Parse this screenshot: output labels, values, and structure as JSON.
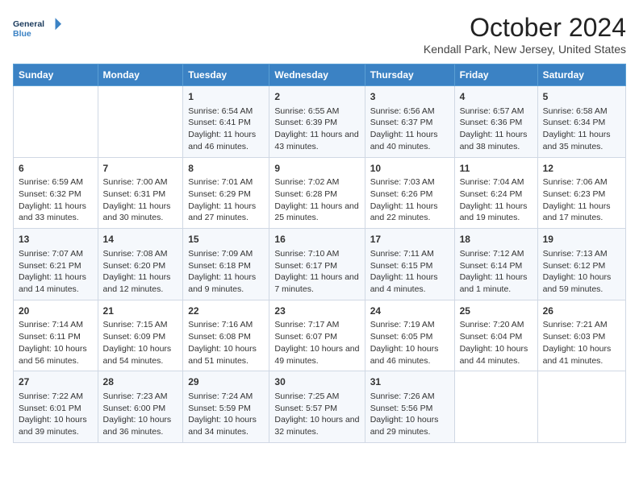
{
  "header": {
    "logo_line1": "General",
    "logo_line2": "Blue",
    "month_title": "October 2024",
    "location": "Kendall Park, New Jersey, United States"
  },
  "days_of_week": [
    "Sunday",
    "Monday",
    "Tuesday",
    "Wednesday",
    "Thursday",
    "Friday",
    "Saturday"
  ],
  "weeks": [
    [
      {
        "day": "",
        "sunrise": "",
        "sunset": "",
        "daylight": ""
      },
      {
        "day": "",
        "sunrise": "",
        "sunset": "",
        "daylight": ""
      },
      {
        "day": "1",
        "sunrise": "Sunrise: 6:54 AM",
        "sunset": "Sunset: 6:41 PM",
        "daylight": "Daylight: 11 hours and 46 minutes."
      },
      {
        "day": "2",
        "sunrise": "Sunrise: 6:55 AM",
        "sunset": "Sunset: 6:39 PM",
        "daylight": "Daylight: 11 hours and 43 minutes."
      },
      {
        "day": "3",
        "sunrise": "Sunrise: 6:56 AM",
        "sunset": "Sunset: 6:37 PM",
        "daylight": "Daylight: 11 hours and 40 minutes."
      },
      {
        "day": "4",
        "sunrise": "Sunrise: 6:57 AM",
        "sunset": "Sunset: 6:36 PM",
        "daylight": "Daylight: 11 hours and 38 minutes."
      },
      {
        "day": "5",
        "sunrise": "Sunrise: 6:58 AM",
        "sunset": "Sunset: 6:34 PM",
        "daylight": "Daylight: 11 hours and 35 minutes."
      }
    ],
    [
      {
        "day": "6",
        "sunrise": "Sunrise: 6:59 AM",
        "sunset": "Sunset: 6:32 PM",
        "daylight": "Daylight: 11 hours and 33 minutes."
      },
      {
        "day": "7",
        "sunrise": "Sunrise: 7:00 AM",
        "sunset": "Sunset: 6:31 PM",
        "daylight": "Daylight: 11 hours and 30 minutes."
      },
      {
        "day": "8",
        "sunrise": "Sunrise: 7:01 AM",
        "sunset": "Sunset: 6:29 PM",
        "daylight": "Daylight: 11 hours and 27 minutes."
      },
      {
        "day": "9",
        "sunrise": "Sunrise: 7:02 AM",
        "sunset": "Sunset: 6:28 PM",
        "daylight": "Daylight: 11 hours and 25 minutes."
      },
      {
        "day": "10",
        "sunrise": "Sunrise: 7:03 AM",
        "sunset": "Sunset: 6:26 PM",
        "daylight": "Daylight: 11 hours and 22 minutes."
      },
      {
        "day": "11",
        "sunrise": "Sunrise: 7:04 AM",
        "sunset": "Sunset: 6:24 PM",
        "daylight": "Daylight: 11 hours and 19 minutes."
      },
      {
        "day": "12",
        "sunrise": "Sunrise: 7:06 AM",
        "sunset": "Sunset: 6:23 PM",
        "daylight": "Daylight: 11 hours and 17 minutes."
      }
    ],
    [
      {
        "day": "13",
        "sunrise": "Sunrise: 7:07 AM",
        "sunset": "Sunset: 6:21 PM",
        "daylight": "Daylight: 11 hours and 14 minutes."
      },
      {
        "day": "14",
        "sunrise": "Sunrise: 7:08 AM",
        "sunset": "Sunset: 6:20 PM",
        "daylight": "Daylight: 11 hours and 12 minutes."
      },
      {
        "day": "15",
        "sunrise": "Sunrise: 7:09 AM",
        "sunset": "Sunset: 6:18 PM",
        "daylight": "Daylight: 11 hours and 9 minutes."
      },
      {
        "day": "16",
        "sunrise": "Sunrise: 7:10 AM",
        "sunset": "Sunset: 6:17 PM",
        "daylight": "Daylight: 11 hours and 7 minutes."
      },
      {
        "day": "17",
        "sunrise": "Sunrise: 7:11 AM",
        "sunset": "Sunset: 6:15 PM",
        "daylight": "Daylight: 11 hours and 4 minutes."
      },
      {
        "day": "18",
        "sunrise": "Sunrise: 7:12 AM",
        "sunset": "Sunset: 6:14 PM",
        "daylight": "Daylight: 11 hours and 1 minute."
      },
      {
        "day": "19",
        "sunrise": "Sunrise: 7:13 AM",
        "sunset": "Sunset: 6:12 PM",
        "daylight": "Daylight: 10 hours and 59 minutes."
      }
    ],
    [
      {
        "day": "20",
        "sunrise": "Sunrise: 7:14 AM",
        "sunset": "Sunset: 6:11 PM",
        "daylight": "Daylight: 10 hours and 56 minutes."
      },
      {
        "day": "21",
        "sunrise": "Sunrise: 7:15 AM",
        "sunset": "Sunset: 6:09 PM",
        "daylight": "Daylight: 10 hours and 54 minutes."
      },
      {
        "day": "22",
        "sunrise": "Sunrise: 7:16 AM",
        "sunset": "Sunset: 6:08 PM",
        "daylight": "Daylight: 10 hours and 51 minutes."
      },
      {
        "day": "23",
        "sunrise": "Sunrise: 7:17 AM",
        "sunset": "Sunset: 6:07 PM",
        "daylight": "Daylight: 10 hours and 49 minutes."
      },
      {
        "day": "24",
        "sunrise": "Sunrise: 7:19 AM",
        "sunset": "Sunset: 6:05 PM",
        "daylight": "Daylight: 10 hours and 46 minutes."
      },
      {
        "day": "25",
        "sunrise": "Sunrise: 7:20 AM",
        "sunset": "Sunset: 6:04 PM",
        "daylight": "Daylight: 10 hours and 44 minutes."
      },
      {
        "day": "26",
        "sunrise": "Sunrise: 7:21 AM",
        "sunset": "Sunset: 6:03 PM",
        "daylight": "Daylight: 10 hours and 41 minutes."
      }
    ],
    [
      {
        "day": "27",
        "sunrise": "Sunrise: 7:22 AM",
        "sunset": "Sunset: 6:01 PM",
        "daylight": "Daylight: 10 hours and 39 minutes."
      },
      {
        "day": "28",
        "sunrise": "Sunrise: 7:23 AM",
        "sunset": "Sunset: 6:00 PM",
        "daylight": "Daylight: 10 hours and 36 minutes."
      },
      {
        "day": "29",
        "sunrise": "Sunrise: 7:24 AM",
        "sunset": "Sunset: 5:59 PM",
        "daylight": "Daylight: 10 hours and 34 minutes."
      },
      {
        "day": "30",
        "sunrise": "Sunrise: 7:25 AM",
        "sunset": "Sunset: 5:57 PM",
        "daylight": "Daylight: 10 hours and 32 minutes."
      },
      {
        "day": "31",
        "sunrise": "Sunrise: 7:26 AM",
        "sunset": "Sunset: 5:56 PM",
        "daylight": "Daylight: 10 hours and 29 minutes."
      },
      {
        "day": "",
        "sunrise": "",
        "sunset": "",
        "daylight": ""
      },
      {
        "day": "",
        "sunrise": "",
        "sunset": "",
        "daylight": ""
      }
    ]
  ]
}
